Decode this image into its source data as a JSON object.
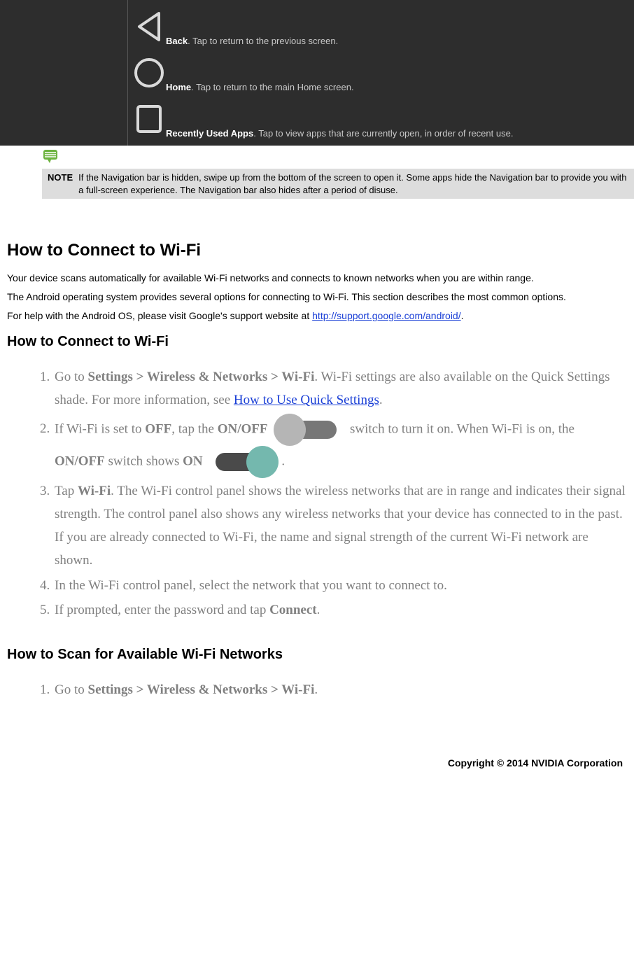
{
  "navbuttons": {
    "back": {
      "label": "Back",
      "desc": ". Tap to return to the previous screen."
    },
    "home": {
      "label": "Home",
      "desc": ". Tap to return to the main Home screen."
    },
    "recent": {
      "label": "Recently Used Apps",
      "desc": ". Tap to view apps that are currently open, in order of recent use."
    }
  },
  "note": {
    "label": "NOTE",
    "text": "If the Navigation bar is hidden, swipe up from the bottom of the screen to open it. Some apps hide the Navigation bar to provide you with a  full-screen experience. The Navigation bar also hides after a period of disuse."
  },
  "wifi": {
    "h2": "How to Connect to Wi-Fi",
    "p1": "Your device scans automatically for available Wi-Fi networks and connects to known networks when you are within range.",
    "p2": "The Android operating system provides several options for connecting to Wi-Fi. This section describes the most common options.",
    "p3a": "For help with the Android OS, please visit Google's support website at ",
    "p3link": "http://support.google.com/android/",
    "p3b": ".",
    "h3": "How to Connect to Wi-Fi",
    "steps": {
      "s1a": "Go to ",
      "s1b": "Settings > Wireless & Networks > Wi-Fi",
      "s1c": ". Wi-Fi settings are also available on the Quick Settings shade. For more information, see ",
      "s1link": "How to Use Quick Settings",
      "s1d": ".",
      "s2a": "If Wi-Fi is set to ",
      "s2b": "OFF",
      "s2c": ", tap the ",
      "s2d": "ON/OFF",
      "s2e": " switch to turn it on. When Wi-Fi is on, the ",
      "s2f": "ON/OFF",
      "s2g": " switch shows ",
      "s2h": "ON",
      "s2i": ".",
      "s3a": "Tap ",
      "s3b": "Wi-Fi",
      "s3c": ". The Wi-Fi control panel shows the wireless networks that are in range and indicates their signal strength. The control panel also shows any wireless networks that your device has connected to in the past. If you are already connected to Wi-Fi, the name and signal strength of the current Wi-Fi network are shown.",
      "s4": "In the Wi-Fi control panel, select the network that you want to connect to.",
      "s5a": "If prompted, enter the password and tap ",
      "s5b": "Connect",
      "s5c": "."
    }
  },
  "scan": {
    "h3": "How to Scan for Available Wi-Fi Networks",
    "s1a": "Go to ",
    "s1b": "Settings > Wireless & Networks > Wi-Fi",
    "s1c": "."
  },
  "copyright": "Copyright © 2014 NVIDIA Corporation"
}
